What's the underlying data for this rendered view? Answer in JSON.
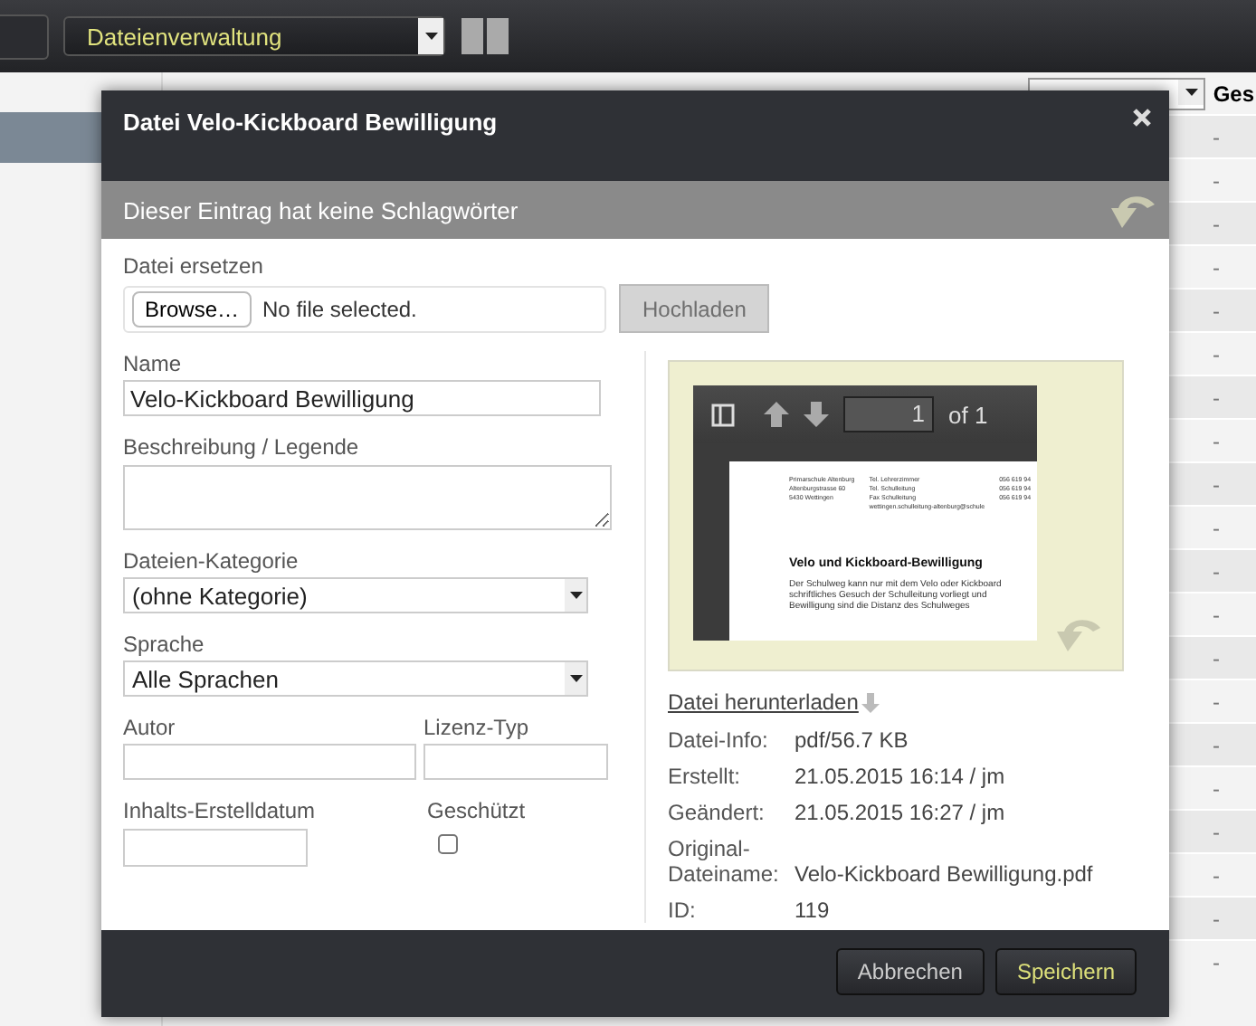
{
  "top_bar": {
    "module_select": "Dateienverwaltung"
  },
  "table": {
    "visible_header": "Ges",
    "rows": [
      "-",
      "-",
      "-",
      "-",
      "-",
      "-",
      "-",
      "-",
      "-",
      "-",
      "-",
      "-",
      "-",
      "-",
      "-",
      "-",
      "-",
      "-",
      "-",
      "-"
    ]
  },
  "dialog": {
    "title": "Datei Velo-Kickboard Bewilligung",
    "tags_notice": "Dieser Eintrag hat keine Schlagwörter",
    "replace_label": "Datei ersetzen",
    "browse_button": "Browse…",
    "file_status": "No file selected.",
    "upload_button": {
      "label": "Hochladen",
      "disabled": true
    },
    "name": {
      "label": "Name",
      "value": "Velo-Kickboard Bewilligung"
    },
    "description": {
      "label": "Beschreibung / Legende"
    },
    "category": {
      "label": "Dateien-Kategorie",
      "value": "(ohne Kategorie)"
    },
    "language": {
      "label": "Sprache",
      "value": "Alle Sprachen"
    },
    "author": {
      "label": "Autor"
    },
    "license": {
      "label": "Lizenz-Typ"
    },
    "created_date": {
      "label": "Inhalts-Erstelldatum"
    },
    "protected": {
      "label": "Geschützt",
      "checked": false
    },
    "preview": {
      "page": "1",
      "page_count": "of 1",
      "sender": [
        "Primarschule Altenburg",
        "Altenburgstrasse 60",
        "5430 Wettingen"
      ],
      "contacts": [
        "Tel. Lehrerzimmer",
        "Tel. Schulleitung",
        "Fax Schulleitung"
      ],
      "numbers": [
        "056 619 94",
        "056 619 94",
        "056 619 94"
      ],
      "email": "wettingen.schulleitung-altenburg@schule",
      "heading": "Velo und Kickboard-Bewilligung",
      "body": [
        "Der Schulweg kann nur mit dem Velo oder Kickboard",
        "schriftliches Gesuch der Schulleitung vorliegt und",
        "Bewilligung sind die Distanz des Schulweges"
      ]
    },
    "download_link": "Datei herunterladen",
    "info": [
      {
        "label": "Datei-Info:",
        "value": "pdf/56.7 KB"
      },
      {
        "label": "Erstellt:",
        "value": "21.05.2015 16:14 / jm"
      },
      {
        "label": "Geändert:",
        "value": "21.05.2015 16:27 / jm"
      },
      {
        "label": "Original-Dateiname:",
        "value": "Velo-Kickboard Bewilligung.pdf"
      },
      {
        "label": "ID:",
        "value": "119"
      }
    ],
    "buttons": [
      {
        "label": "Abbrechen",
        "kind": "cancel"
      },
      {
        "label": "Speichern",
        "kind": "primary"
      }
    ]
  }
}
